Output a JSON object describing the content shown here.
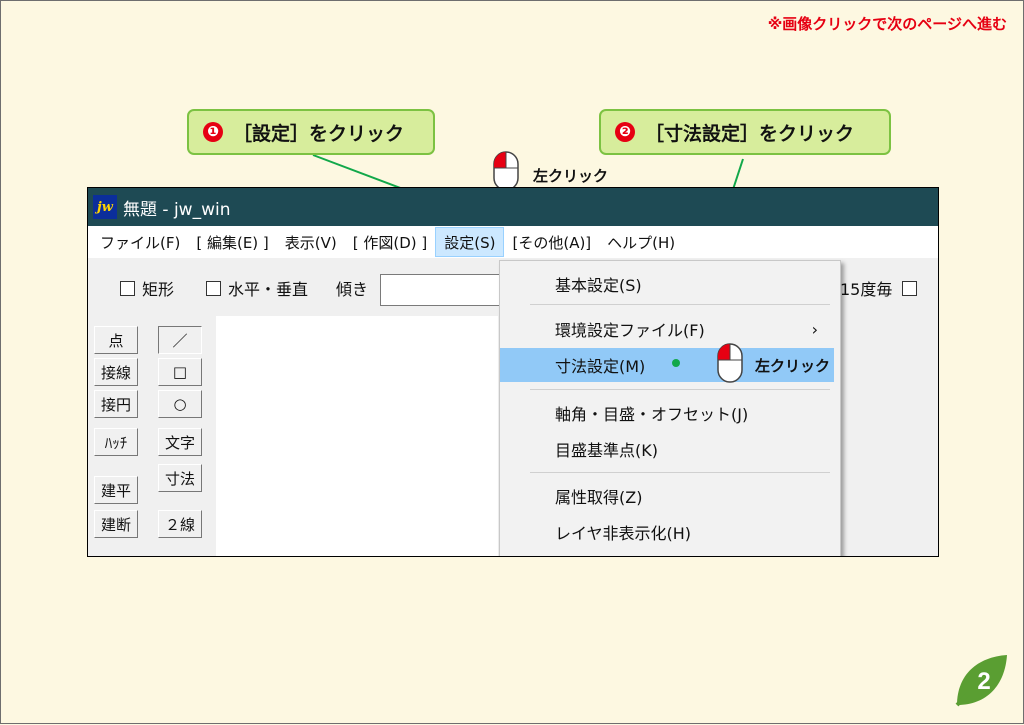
{
  "notice": "※画像クリックで次のページへ進む",
  "callouts": [
    {
      "number": "❶",
      "text": "［設定］をクリック"
    },
    {
      "number": "❷",
      "text": "［寸法設定］をクリック"
    }
  ],
  "mouse_label": "左クリック",
  "window": {
    "logo": "jw",
    "title": "無題 - jw_win"
  },
  "menubar": [
    "ファイル(F)",
    "[ 編集(E) ]",
    "表示(V)",
    "[ 作図(D) ]",
    "設定(S)",
    "[その他(A)]",
    "ヘルプ(H)"
  ],
  "toolbar": {
    "rect_label": "矩形",
    "hv_label": "水平・垂直",
    "tilt_label": "傾き",
    "deg_label": "15度毎"
  },
  "tools_left": [
    "点",
    "接線",
    "接円",
    "ﾊｯﾁ",
    "建平",
    "建断"
  ],
  "tools_right": [
    "／",
    "□",
    "○",
    "文字",
    "寸法",
    "２線"
  ],
  "dropdown": [
    "基本設定(S)",
    "環境設定ファイル(F)",
    "寸法設定(M)",
    "軸角・目盛・オフセット(J)",
    "目盛基準点(K)",
    "属性取得(Z)",
    "レイヤ非表示化(H)"
  ],
  "submenu_arrow": "›",
  "page_number": "2",
  "colors": {
    "background": "#fdf8e1",
    "callout_fill": "#d7ed9c",
    "callout_border": "#7cc242",
    "leader_line": "#12a84a",
    "titlebar": "#1e4a54",
    "highlight": "#91c9f7",
    "notice": "#e60012",
    "badge": "#5a9e32"
  }
}
